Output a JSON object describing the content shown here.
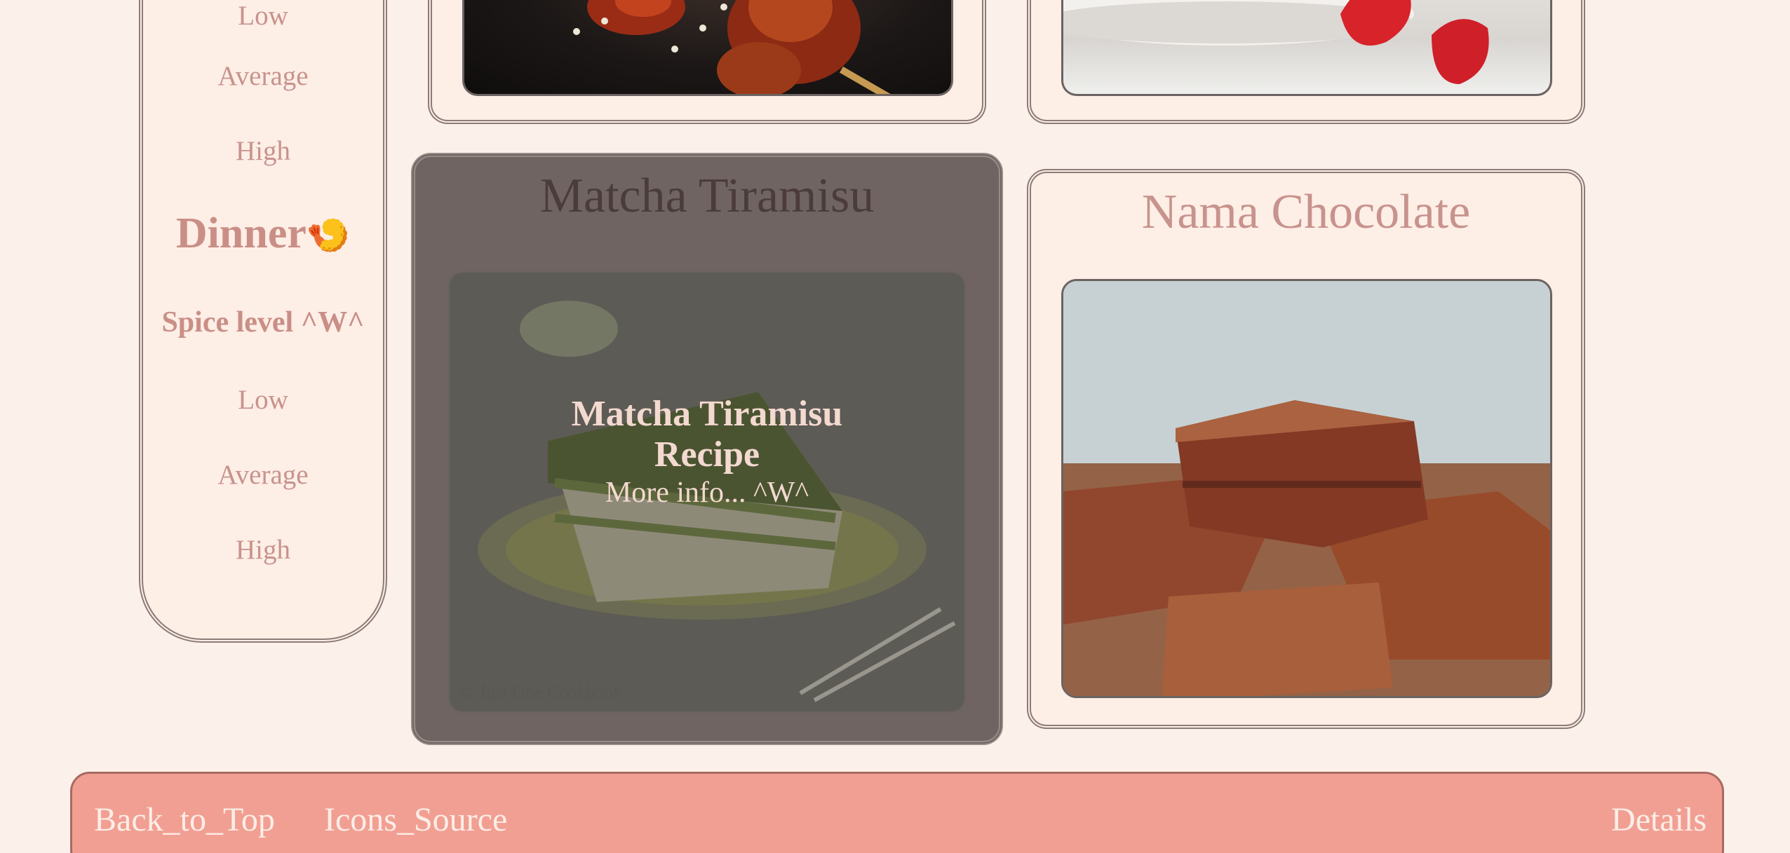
{
  "sidebar": {
    "top_items": [
      "Low",
      "Average",
      "High"
    ],
    "dinner_heading": "Dinner",
    "dinner_emoji": "🍤",
    "spice_label": "Spice level ^W^",
    "levels": [
      "Low",
      "Average",
      "High"
    ]
  },
  "cards": {
    "matcha": {
      "title": "Matcha Tiramisu",
      "overlay_title_line1": "Matcha Tiramisu",
      "overlay_title_line2": "Recipe",
      "overlay_more": "More info... ^W^",
      "watermark": "© Just One Cookbook"
    },
    "nama": {
      "title": "Nama Chocolate"
    }
  },
  "footer": {
    "back_to_top": "Back_to_Top",
    "icons_source": "Icons_Source",
    "details": "Details"
  },
  "colors": {
    "background": "#fbf1ea",
    "card": "#fdeee6",
    "accent_text": "#c7938c",
    "footer": "#f29f93"
  }
}
